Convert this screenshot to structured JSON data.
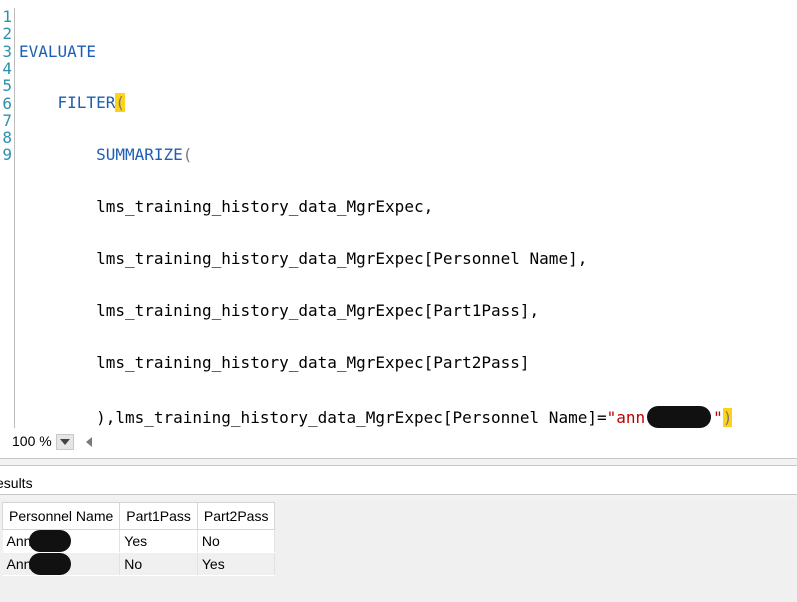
{
  "editor": {
    "line_numbers": [
      "1",
      "2",
      "3",
      "4",
      "5",
      "6",
      "7",
      "8",
      "9"
    ],
    "code": {
      "l1": "EVALUATE",
      "l2_kw": "FILTER",
      "l2_paren": "(",
      "l3_kw": "SUMMARIZE",
      "l3_paren": "(",
      "l4": "lms_training_history_data_MgrExpec,",
      "l5": "lms_training_history_data_MgrExpec[Personnel Name],",
      "l6": "lms_training_history_data_MgrExpec[Part1Pass],",
      "l7": "lms_training_history_data_MgrExpec[Part2Pass]",
      "l8_prefix": "),lms_training_history_data_MgrExpec[Personnel Name]=",
      "l8_str_open": "\"ann",
      "l8_str_close": "\"",
      "l8_paren": ")"
    }
  },
  "zoom": {
    "level": "100 %"
  },
  "results_tab": {
    "label": "esults"
  },
  "grid": {
    "columns": [
      "Personnel Name",
      "Part1Pass",
      "Part2Pass"
    ],
    "rows": [
      {
        "name": "Ann",
        "part1": "Yes",
        "part2": "No"
      },
      {
        "name": "Ann",
        "part1": "No",
        "part2": "Yes"
      }
    ]
  },
  "colors": {
    "keyword": "#1e5fb4",
    "string": "#c00000",
    "line_number": "#2b91af",
    "bracket_highlight": "#ffd21a"
  },
  "icons": [
    "dropdown-arrow-icon",
    "scroll-left-arrow-icon"
  ]
}
